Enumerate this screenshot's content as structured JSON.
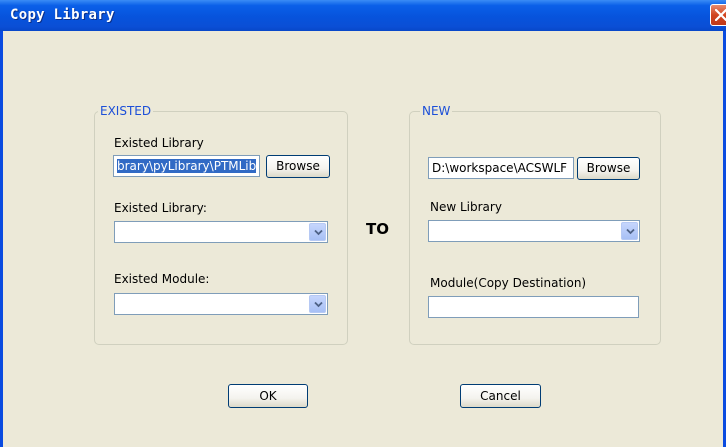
{
  "window": {
    "title": "Copy Library"
  },
  "existed": {
    "legend": "EXISTED",
    "library_path_label": "Existed Library",
    "library_path_value": "brary\\pyLibrary\\PTMLib",
    "browse_label": "Browse",
    "library_select_label": "Existed Library:",
    "library_select_value": "",
    "module_select_label": "Existed Module:",
    "module_select_value": ""
  },
  "separator_label": "TO",
  "new": {
    "legend": "NEW",
    "path_value": "D:\\workspace\\ACSWLF",
    "browse_label": "Browse",
    "library_select_label": "New Library",
    "library_select_value": "",
    "module_label": "Module(Copy Destination)",
    "module_value": ""
  },
  "buttons": {
    "ok_label": "OK",
    "cancel_label": "Cancel"
  }
}
